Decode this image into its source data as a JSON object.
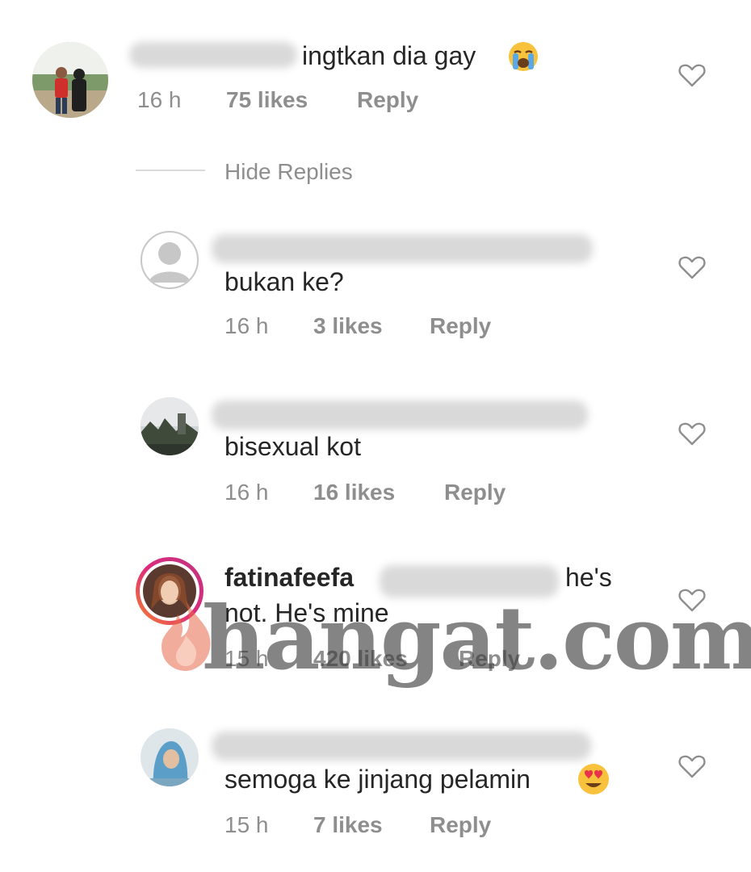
{
  "comments": [
    {
      "text": "ingtkan dia gay",
      "time": "16 h",
      "likes": "75 likes",
      "reply": "Reply"
    },
    {
      "text": "bukan ke?",
      "time": "16 h",
      "likes": "3 likes",
      "reply": "Reply"
    },
    {
      "text": "bisexual kot",
      "time": "16 h",
      "likes": "16 likes",
      "reply": "Reply"
    },
    {
      "username": "fatinafeefa",
      "text_suffix": "he's",
      "text_line2": "not. He's mine",
      "time": "15 h",
      "likes": "420 likes",
      "reply": "Reply"
    },
    {
      "text": "semoga ke jinjang pelamin",
      "time": "15 h",
      "likes": "7 likes",
      "reply": "Reply"
    }
  ],
  "thread": {
    "hide_replies": "Hide Replies"
  },
  "watermark": {
    "text": "hangat.com"
  },
  "icons": {
    "heart": "heart-outline-icon",
    "crying_emoji": "loudly-crying-face-emoji",
    "heart_eyes_emoji": "smiling-face-with-heart-eyes-emoji"
  },
  "colors": {
    "text": "#262626",
    "meta": "#8e8e8e",
    "story_ring_start": "#f58529",
    "story_ring_end": "#c13584"
  }
}
